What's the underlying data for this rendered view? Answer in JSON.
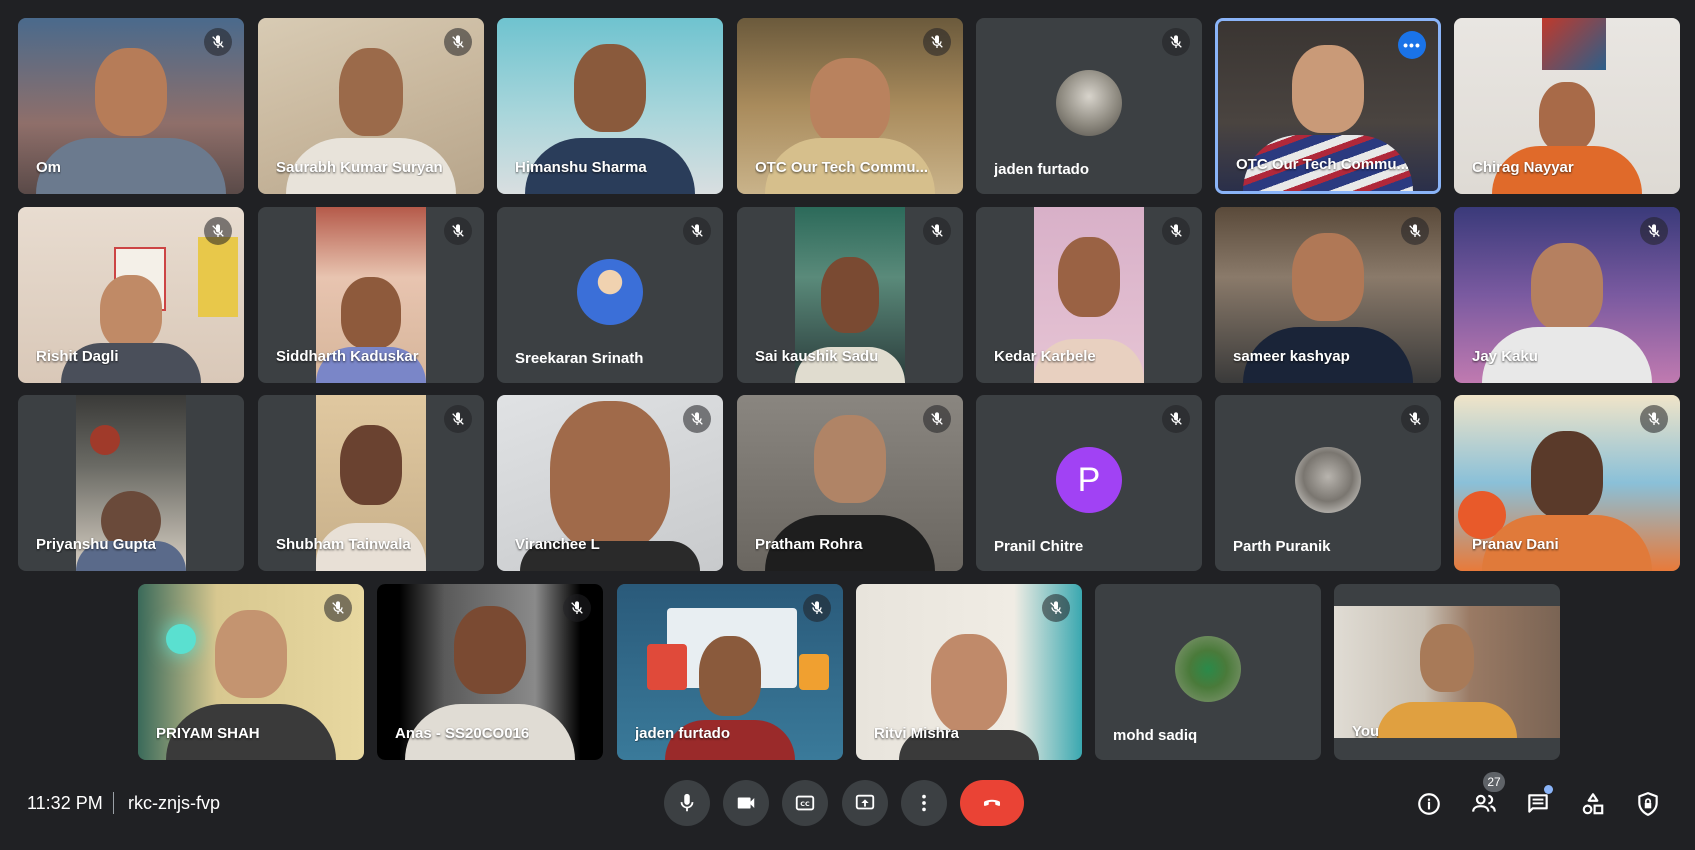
{
  "participants": [
    {
      "name": "Om",
      "muted": true
    },
    {
      "name": "Saurabh Kumar Suryan",
      "muted": true
    },
    {
      "name": "Himanshu Sharma",
      "muted": false
    },
    {
      "name": "OTC Our Tech Commu...",
      "muted": true
    },
    {
      "name": "jaden furtado",
      "muted": true
    },
    {
      "name": "OTC Our Tech Commu...",
      "muted": false
    },
    {
      "name": "Chirag Nayyar",
      "muted": false
    },
    {
      "name": "Rishit Dagli",
      "muted": true
    },
    {
      "name": "Siddharth Kaduskar",
      "muted": true
    },
    {
      "name": "Sreekaran Srinath",
      "muted": true
    },
    {
      "name": "Sai kaushik Sadu",
      "muted": true
    },
    {
      "name": "Kedar Karbele",
      "muted": true
    },
    {
      "name": "sameer kashyap",
      "muted": true
    },
    {
      "name": "Jay Kaku",
      "muted": true
    },
    {
      "name": "Priyanshu Gupta",
      "muted": false
    },
    {
      "name": "Shubham Tainwala",
      "muted": true
    },
    {
      "name": "Viranchee L",
      "muted": true
    },
    {
      "name": "Pratham Rohra",
      "muted": true
    },
    {
      "name": "Pranil Chitre",
      "muted": true,
      "avatar_letter": "P"
    },
    {
      "name": "Parth Puranik",
      "muted": true
    },
    {
      "name": "Pranav Dani",
      "muted": true
    },
    {
      "name": "PRIYAM SHAH",
      "muted": true
    },
    {
      "name": "Anas - SS20CO016",
      "muted": true
    },
    {
      "name": "jaden furtado",
      "muted": true
    },
    {
      "name": "Ritvi Mishra",
      "muted": true
    },
    {
      "name": "mohd sadiq",
      "muted": false
    },
    {
      "name": "You",
      "muted": false
    }
  ],
  "meeting": {
    "time": "11:32 PM",
    "code": "rkc-znjs-fvp",
    "participant_count": "27"
  },
  "colors": {
    "background": "#202124",
    "tile": "#3c4043",
    "end_call": "#ea4335",
    "accent": "#8ab4f8",
    "avatar_purple": "#a142f4"
  },
  "icons": [
    "mic-off-icon",
    "mic-icon",
    "camera-icon",
    "captions-icon",
    "present-icon",
    "more-vert-icon",
    "end-call-icon",
    "info-icon",
    "people-icon",
    "chat-icon",
    "activities-icon",
    "host-controls-icon",
    "more-options-icon"
  ]
}
